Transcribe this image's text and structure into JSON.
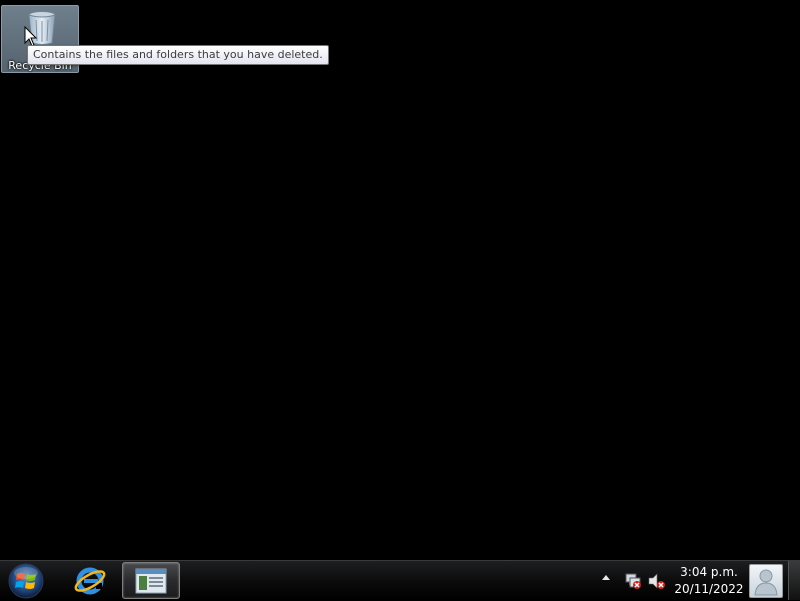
{
  "desktop": {
    "icons": [
      {
        "label": "Recycle Bin",
        "icon": "recycle-bin-icon"
      }
    ],
    "tooltip": "Contains the files and folders that you have deleted."
  },
  "taskbar": {
    "start_icon": "windows-start-orb-icon",
    "pinned": [
      {
        "icon": "internet-explorer-icon"
      },
      {
        "icon": "windows-explorer-icon"
      }
    ],
    "tray": {
      "overflow_icon": "chevron-up-icon",
      "network_icon": "network-disconnected-icon",
      "volume_icon": "volume-muted-icon"
    },
    "clock": {
      "time": "3:04 p.m.",
      "date": "20/11/2022"
    },
    "user_icon": "user-avatar-icon"
  }
}
